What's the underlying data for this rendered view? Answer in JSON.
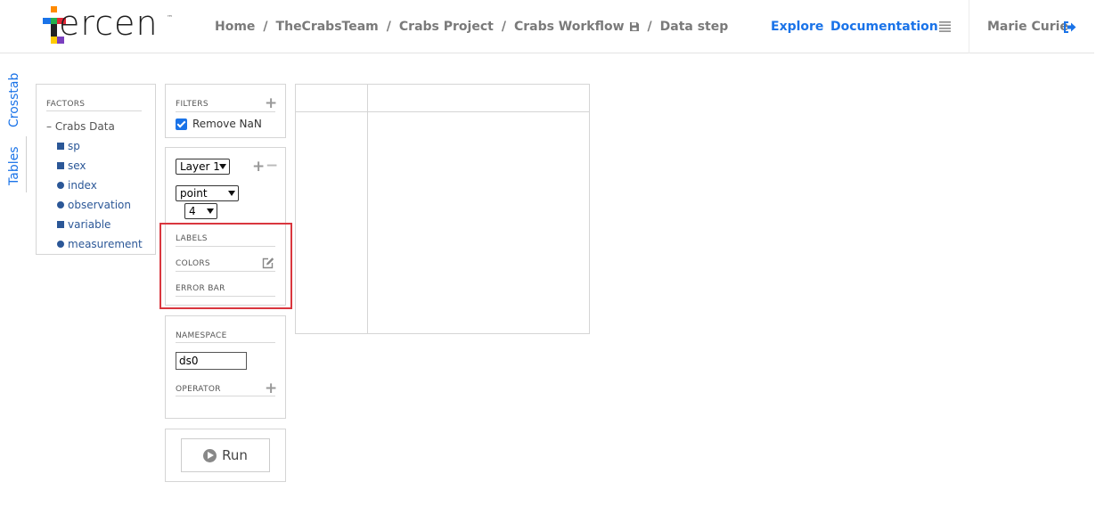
{
  "header": {
    "logo": {
      "text": "ercen",
      "tm": "™"
    },
    "breadcrumb": {
      "home": "Home",
      "team": "TheCrabsTeam",
      "project": "Crabs Project",
      "workflow": "Crabs Workflow",
      "step": "Data step",
      "separator": "/"
    },
    "nav": {
      "explore": "Explore",
      "documentation": "Documentation",
      "user": "Marie Curie"
    }
  },
  "side_tabs": {
    "crosstab": "Crosstab",
    "tables": "Tables"
  },
  "factors": {
    "title": "FACTORS",
    "root": "– Crabs Data",
    "items": [
      {
        "label": "sp",
        "shape": "square"
      },
      {
        "label": "sex",
        "shape": "square"
      },
      {
        "label": "index",
        "shape": "circle"
      },
      {
        "label": "observation",
        "shape": "circle"
      },
      {
        "label": "variable",
        "shape": "square"
      },
      {
        "label": "measurement",
        "shape": "circle"
      }
    ]
  },
  "filters": {
    "title": "FILTERS",
    "remove_nan": {
      "label": "Remove NaN",
      "checked": true
    }
  },
  "layer": {
    "layer_select": "Layer 1",
    "geom_select": "point",
    "size_select": "4",
    "labels_title": "LABELS",
    "colors_title": "COLORS",
    "errorbar_title": "ERROR BAR"
  },
  "namespace": {
    "title": "NAMESPACE",
    "value": "ds0",
    "operator_title": "OPERATOR"
  },
  "run": {
    "label": "Run"
  },
  "colors": {
    "accent": "#1a73e8",
    "factor": "#2b5797",
    "highlight": "#d9363e"
  }
}
